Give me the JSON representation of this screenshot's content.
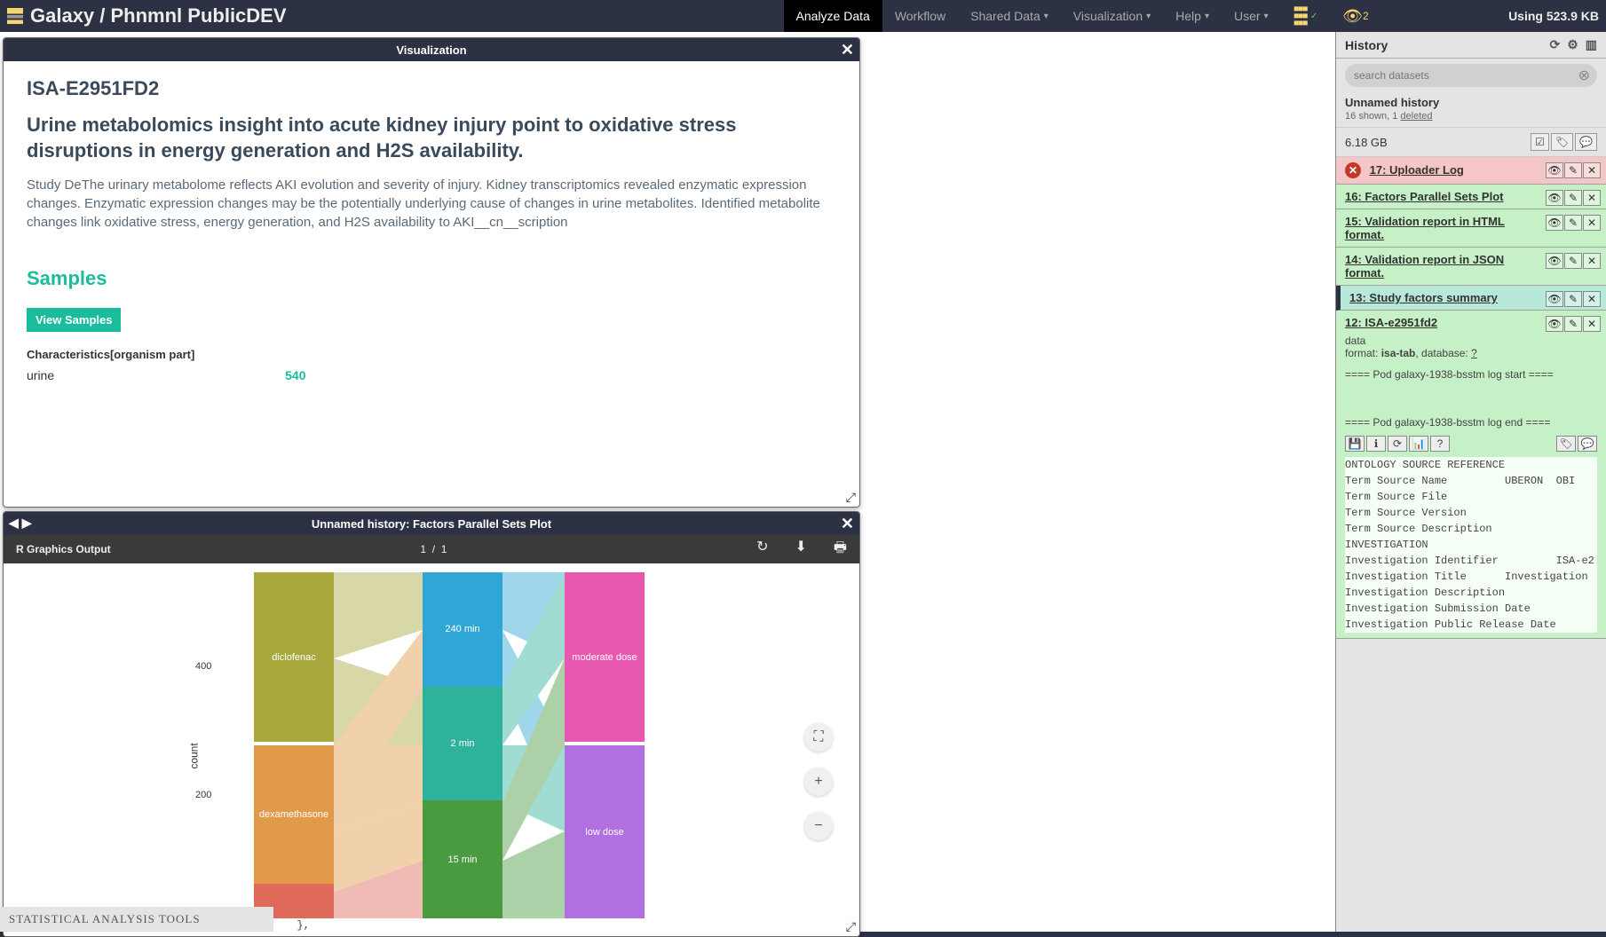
{
  "nav": {
    "brand": "Galaxy / Phnmnl PublicDEV",
    "items": [
      "Analyze Data",
      "Workflow",
      "Shared Data",
      "Visualization",
      "Help",
      "User"
    ],
    "active_index": 0,
    "eye_count": "2",
    "usage": "Using 523.9 KB"
  },
  "tool_footer": "STATISTICAL ANALYSIS TOOLS",
  "visWin": {
    "title": "Visualization",
    "isa_id": "ISA-E2951FD2",
    "study_title": "Urine metabolomics insight into acute kidney injury point to oxidative stress disruptions in energy generation and H2S availability.",
    "abstract": "Study DeThe urinary metabolome reflects AKI evolution and severity of injury. Kidney transcriptomics revealed enzymatic expression changes. Enzymatic expression changes may be the potentially underlying cause of changes in urine metabolites. Identified metabolite changes link oxidative stress, energy generation, and H2S availability to AKI__cn__scription",
    "samples_heading": "Samples",
    "view_samples_btn": "View Samples",
    "char_label": "Characteristics[organism part]",
    "char_key": "urine",
    "char_val": "540"
  },
  "plotWin": {
    "title": "Unnamed history: Factors Parallel Sets Plot",
    "rtitle": "R Graphics Output",
    "page_cur": "1",
    "page_total": "1",
    "ylabel": "count",
    "yticks": [
      "400",
      "200"
    ],
    "axis1": [
      {
        "label": "diclofenac",
        "color": "#a8a83d"
      },
      {
        "label": "dexamethasone",
        "color": "#e09a4a"
      }
    ],
    "axis2": [
      {
        "label": "240 min",
        "color": "#2fa6d6"
      },
      {
        "label": "2 min",
        "color": "#2fb29b"
      },
      {
        "label": "15 min",
        "color": "#4a9b3f"
      }
    ],
    "axis3": [
      {
        "label": "moderate dose",
        "color": "#e858b0"
      },
      {
        "label": "low dose",
        "color": "#b070e0"
      }
    ]
  },
  "history": {
    "heading": "History",
    "search_placeholder": "search datasets",
    "name": "Unnamed history",
    "shown_count": "16",
    "shown_label": "shown,",
    "deleted_count": "1",
    "deleted_label": "deleted",
    "size": "6.18 GB",
    "items": [
      {
        "id": "17",
        "name": "Uploader Log",
        "state": "err"
      },
      {
        "id": "16",
        "name": "Factors Parallel Sets Plot",
        "state": "ok"
      },
      {
        "id": "15",
        "name": "Validation report in HTML format.",
        "state": "ok"
      },
      {
        "id": "14",
        "name": "Validation report in JSON format.",
        "state": "ok"
      },
      {
        "id": "13",
        "name": "Study factors summary",
        "state": "sel"
      },
      {
        "id": "12",
        "name": "ISA-e2951fd2",
        "state": "ok",
        "expanded": true
      }
    ],
    "expanded": {
      "type_line": "data",
      "format_label": "format:",
      "format": "isa-tab",
      "db_label": ", database:",
      "db": "?",
      "log1": "==== Pod galaxy-1938-bsstm log start ====",
      "log2": "==== Pod galaxy-1938-bsstm log end ====",
      "peek": "ONTOLOGY SOURCE REFERENCE\nTerm Source Name         UBERON  OBI\nTerm Source File\nTerm Source Version\nTerm Source Description\nINVESTIGATION\nInvestigation Identifier         ISA-e2\nInvestigation Title      Investigation\nInvestigation Description\nInvestigation Submission Date\nInvestigation Public Release Date"
    }
  }
}
